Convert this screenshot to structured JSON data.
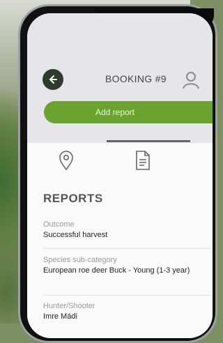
{
  "header": {
    "title": "BOOKING #9",
    "add_button_label": "Add report"
  },
  "reports": {
    "heading": "REPORTS",
    "fields": [
      {
        "label": "Outcome",
        "value": "Successful harvest"
      },
      {
        "label": "Species sub-category",
        "value": "European roe deer Buck - Young (1-3 year)"
      },
      {
        "label": "Hunter/Shooter",
        "value": "Imre Mádi"
      }
    ]
  },
  "tabs": [
    {
      "icon": "location-pin-icon"
    },
    {
      "icon": "document-icon"
    }
  ],
  "colors": {
    "accent_green": "#6aa42f",
    "back_button": "#2e3b2e"
  }
}
